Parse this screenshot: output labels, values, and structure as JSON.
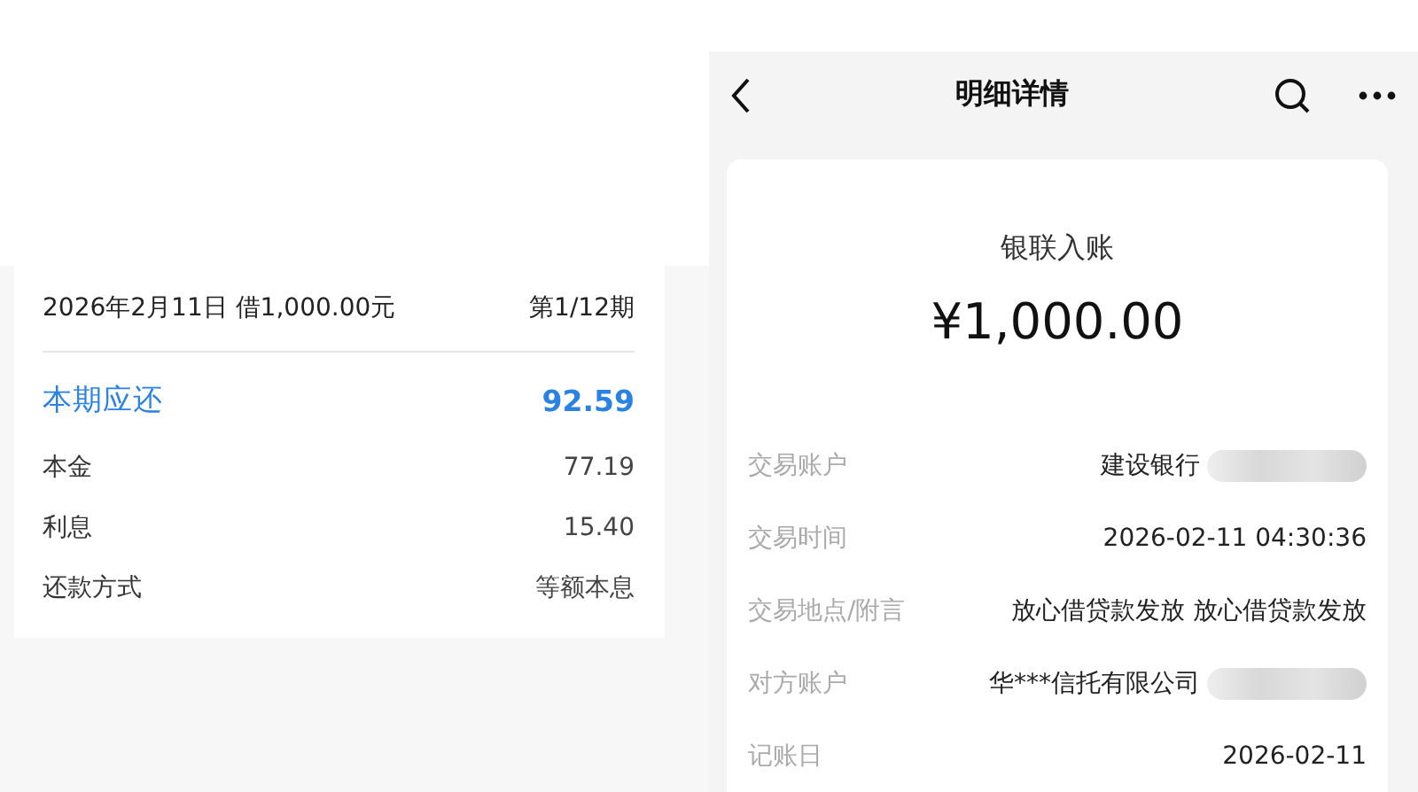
{
  "loan_card": {
    "header": {
      "date_amount": "2026年2月11日 借1,000.00元",
      "period": "第1/12期"
    },
    "rows": [
      {
        "label": "本期应还",
        "value": "92.59",
        "kind": "highlight"
      },
      {
        "label": "本金",
        "value": "77.19",
        "kind": "plain"
      },
      {
        "label": "利息",
        "value": "15.40",
        "kind": "plain"
      },
      {
        "label": "还款方式",
        "value": "等额本息",
        "kind": "plain"
      }
    ]
  },
  "detail": {
    "title": "明细详情",
    "type": "银联入账",
    "amount": "¥1,000.00",
    "fields": [
      {
        "label": "交易账户",
        "value": "建设银行",
        "redacted": true
      },
      {
        "label": "交易时间",
        "value": "2026-02-11 04:30:36",
        "redacted": false
      },
      {
        "label": "交易地点/附言",
        "value": "放心借贷款发放 放心借贷款发放",
        "redacted": false
      },
      {
        "label": "对方账户",
        "value": "华***信托有限公司",
        "redacted": true
      },
      {
        "label": "记账日",
        "value": "2026-02-11",
        "redacted": false
      }
    ]
  }
}
